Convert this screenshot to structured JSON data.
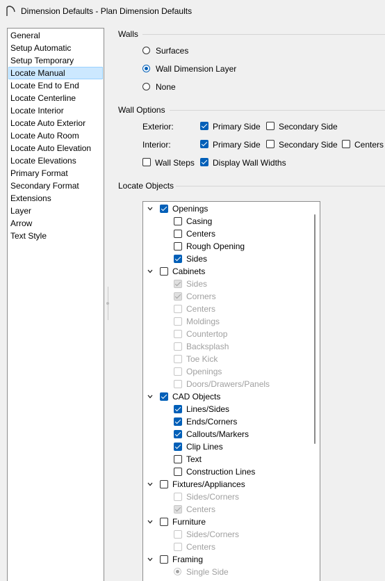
{
  "window": {
    "title": "Dimension Defaults - Plan Dimension Defaults"
  },
  "nav": {
    "items": [
      "General",
      "Setup Automatic",
      "Setup Temporary",
      "Locate Manual",
      "Locate End to End",
      "Locate Centerline",
      "Locate Interior",
      "Locate Auto Exterior",
      "Locate Auto Room",
      "Locate Auto Elevation",
      "Locate Elevations",
      "Primary Format",
      "Secondary Format",
      "Extensions",
      "Layer",
      "Arrow",
      "Text Style"
    ],
    "selected": "Locate Manual"
  },
  "walls": {
    "label": "Walls",
    "options": [
      {
        "label": "Surfaces",
        "checked": false
      },
      {
        "label": "Wall Dimension Layer",
        "checked": true
      },
      {
        "label": "None",
        "checked": false
      }
    ]
  },
  "wall_options": {
    "label": "Wall Options",
    "exterior_label": "Exterior:",
    "interior_label": "Interior:",
    "exterior": [
      {
        "label": "Primary Side",
        "checked": true
      },
      {
        "label": "Secondary Side",
        "checked": false
      }
    ],
    "interior": [
      {
        "label": "Primary Side",
        "checked": true
      },
      {
        "label": "Secondary Side",
        "checked": false
      },
      {
        "label": "Centers",
        "checked": false
      }
    ],
    "extra": [
      {
        "label": "Wall Steps",
        "checked": false
      },
      {
        "label": "Display Wall Widths",
        "checked": true
      }
    ]
  },
  "locate_objects": {
    "label": "Locate Objects",
    "tree": [
      {
        "label": "Openings",
        "level": 0,
        "checked": true,
        "disabled": false
      },
      {
        "label": "Casing",
        "level": 1,
        "checked": false,
        "disabled": false
      },
      {
        "label": "Centers",
        "level": 1,
        "checked": false,
        "disabled": false
      },
      {
        "label": "Rough Opening",
        "level": 1,
        "checked": false,
        "disabled": false
      },
      {
        "label": "Sides",
        "level": 1,
        "checked": true,
        "disabled": false
      },
      {
        "label": "Cabinets",
        "level": 0,
        "checked": false,
        "disabled": false
      },
      {
        "label": "Sides",
        "level": 1,
        "checked": true,
        "disabled": true
      },
      {
        "label": "Corners",
        "level": 1,
        "checked": true,
        "disabled": true
      },
      {
        "label": "Centers",
        "level": 1,
        "checked": false,
        "disabled": true
      },
      {
        "label": "Moldings",
        "level": 1,
        "checked": false,
        "disabled": true
      },
      {
        "label": "Countertop",
        "level": 1,
        "checked": false,
        "disabled": true
      },
      {
        "label": "Backsplash",
        "level": 1,
        "checked": false,
        "disabled": true
      },
      {
        "label": "Toe Kick",
        "level": 1,
        "checked": false,
        "disabled": true
      },
      {
        "label": "Openings",
        "level": 1,
        "checked": false,
        "disabled": true
      },
      {
        "label": "Doors/Drawers/Panels",
        "level": 1,
        "checked": false,
        "disabled": true
      },
      {
        "label": "CAD Objects",
        "level": 0,
        "checked": true,
        "disabled": false
      },
      {
        "label": "Lines/Sides",
        "level": 1,
        "checked": true,
        "disabled": false
      },
      {
        "label": "Ends/Corners",
        "level": 1,
        "checked": true,
        "disabled": false
      },
      {
        "label": "Callouts/Markers",
        "level": 1,
        "checked": true,
        "disabled": false
      },
      {
        "label": "Clip Lines",
        "level": 1,
        "checked": true,
        "disabled": false
      },
      {
        "label": "Text",
        "level": 1,
        "checked": false,
        "disabled": false
      },
      {
        "label": "Construction Lines",
        "level": 1,
        "checked": false,
        "disabled": false
      },
      {
        "label": "Fixtures/Appliances",
        "level": 0,
        "checked": false,
        "disabled": false
      },
      {
        "label": "Sides/Corners",
        "level": 1,
        "checked": false,
        "disabled": true
      },
      {
        "label": "Centers",
        "level": 1,
        "checked": true,
        "disabled": true
      },
      {
        "label": "Furniture",
        "level": 0,
        "checked": false,
        "disabled": false
      },
      {
        "label": "Sides/Corners",
        "level": 1,
        "checked": false,
        "disabled": true
      },
      {
        "label": "Centers",
        "level": 1,
        "checked": false,
        "disabled": true
      },
      {
        "label": "Framing",
        "level": 0,
        "checked": false,
        "disabled": false
      },
      {
        "label": "Single Side",
        "level": 1,
        "checked": true,
        "disabled": true,
        "radio": true
      }
    ]
  },
  "icons": {
    "app": "app-arc-icon",
    "expand": "chevron-down-icon"
  },
  "colors": {
    "accent": "#005fb8",
    "selection": "#cce8ff"
  }
}
